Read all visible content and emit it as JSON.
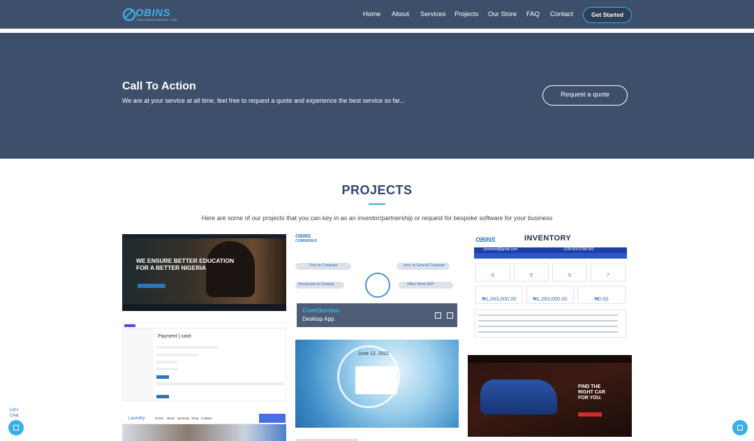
{
  "header": {
    "logo_text": "OBINS",
    "logo_subtext": "TECHNOLOGIES LTD",
    "nav": [
      "Home",
      "About",
      "Services",
      "Projects",
      "Our Store",
      "FAQ",
      "Contact"
    ],
    "cta_button": "Get Started"
  },
  "cta": {
    "title": "Call To Action",
    "text": "We are at your service at all time, feel free to request a quote and experience the best service so far...",
    "button": "Request a quote"
  },
  "projects": {
    "title": "PROJECTS",
    "subtitle": "Here are some of our projects that you can key in as an investor/partnership or request for bespoke software for your business",
    "education": {
      "headline_1": "WE ENSURE BETTER EDUCATION",
      "headline_2": "FOR A BETTER NIGERIA"
    },
    "comgenius": {
      "logo": "OBINS",
      "logo_sub": "COMGENIUS",
      "pills": [
        "Turn on Computer",
        "Intro. to General Computer",
        "Introduction to Desktop",
        "Office Word 2007"
      ],
      "overlay_title": "ComGenius",
      "overlay_subtitle": "Desktop App."
    },
    "inventory": {
      "logo": "OBINS",
      "title": "INVENTORY",
      "email": "jocement@gmail.com",
      "phone": "+234 818 6788 343",
      "stats": [
        "6",
        "5",
        "5",
        "7"
      ],
      "money": [
        "₦1,263,000.00",
        "₦1,263,000.00",
        "₦0.00"
      ]
    },
    "payment": {
      "title": "Payment | cash"
    },
    "calendar": {
      "date": "June 12, 2021",
      "time": "PM"
    },
    "car": {
      "line1": "FIND THE",
      "line2": "RIGHT CAR",
      "line3": "FOR YOU."
    },
    "laundry": {
      "brand": "Laundry",
      "nav": [
        "Home",
        "About",
        "Services",
        "Shop",
        "Contact"
      ]
    }
  },
  "chat": {
    "label_1": "Let's",
    "label_2": "Chat"
  },
  "colors": {
    "navy": "#3e4f6b",
    "accent": "#3aaee6",
    "title": "#34456b"
  }
}
